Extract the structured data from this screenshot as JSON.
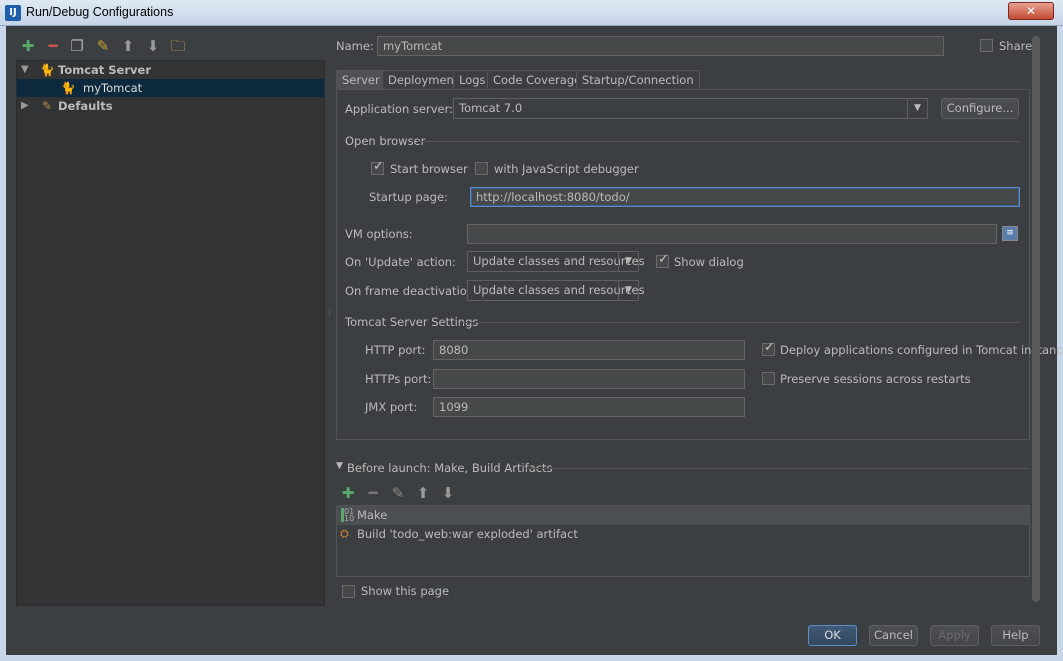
{
  "window": {
    "title": "Run/Debug Configurations",
    "icon": "idea-app-icon",
    "close": "✕"
  },
  "toolbar": {
    "icons": [
      "add-icon",
      "remove-icon",
      "copy-icon",
      "edit-defaults-icon",
      "move-up-icon",
      "move-down-icon",
      "folder-icon"
    ]
  },
  "tree": {
    "items": [
      {
        "label": "Tomcat Server",
        "expanded": true,
        "icon": "tomcat-icon"
      },
      {
        "label": "myTomcat",
        "selected": true,
        "icon": "tomcat-icon"
      },
      {
        "label": "Defaults",
        "expanded": false,
        "icon": "wrench-icon"
      }
    ]
  },
  "name_field": {
    "label": "Name:",
    "value": "myTomcat"
  },
  "share": {
    "label": "Share",
    "checked": false
  },
  "tabs": [
    "Server",
    "Deployment",
    "Logs",
    "Code Coverage",
    "Startup/Connection"
  ],
  "server": {
    "app_server_label": "Application server:",
    "app_server_value": "Tomcat 7.0",
    "configure_label": "Configure...",
    "open_browser_label": "Open browser",
    "start_browser_label": "Start browser",
    "start_browser_checked": true,
    "js_debugger_label": "with JavaScript debugger",
    "js_debugger_checked": false,
    "startup_page_label": "Startup page:",
    "startup_page_value": "http://localhost:8080/todo/",
    "vm_options_label": "VM options:",
    "vm_options_value": "",
    "on_update_label": "On 'Update' action:",
    "on_update_value": "Update classes and resources",
    "show_dialog_label": "Show dialog",
    "show_dialog_checked": true,
    "on_frame_label": "On frame deactivation:",
    "on_frame_value": "Update classes and resources",
    "tomcat_settings_label": "Tomcat Server Settings",
    "http_port_label": "HTTP port:",
    "http_port_value": "8080",
    "https_port_label": "HTTPs port:",
    "https_port_value": "",
    "jmx_port_label": "JMX port:",
    "jmx_port_value": "1099",
    "deploy_label": "Deploy applications configured in Tomcat instance",
    "deploy_checked": true,
    "preserve_label": "Preserve sessions across restarts",
    "preserve_checked": false
  },
  "before_launch": {
    "label": "Before launch: Make, Build Artifacts",
    "toolbar_icons": [
      "add-icon",
      "remove-icon",
      "edit-icon",
      "move-up-icon",
      "move-down-icon"
    ],
    "items": [
      {
        "label": "Make",
        "icon": "make-icon",
        "selected": true
      },
      {
        "label": "Build 'todo_web:war exploded' artifact",
        "icon": "artifact-icon"
      }
    ]
  },
  "show_page": {
    "label": "Show this page",
    "checked": false
  },
  "buttons": {
    "ok": "OK",
    "cancel": "Cancel",
    "apply": "Apply",
    "help": "Help"
  },
  "colors": {
    "accent": "#5a8cc8",
    "selection": "#0d293e",
    "add": "#59a869",
    "remove": "#c75450"
  }
}
